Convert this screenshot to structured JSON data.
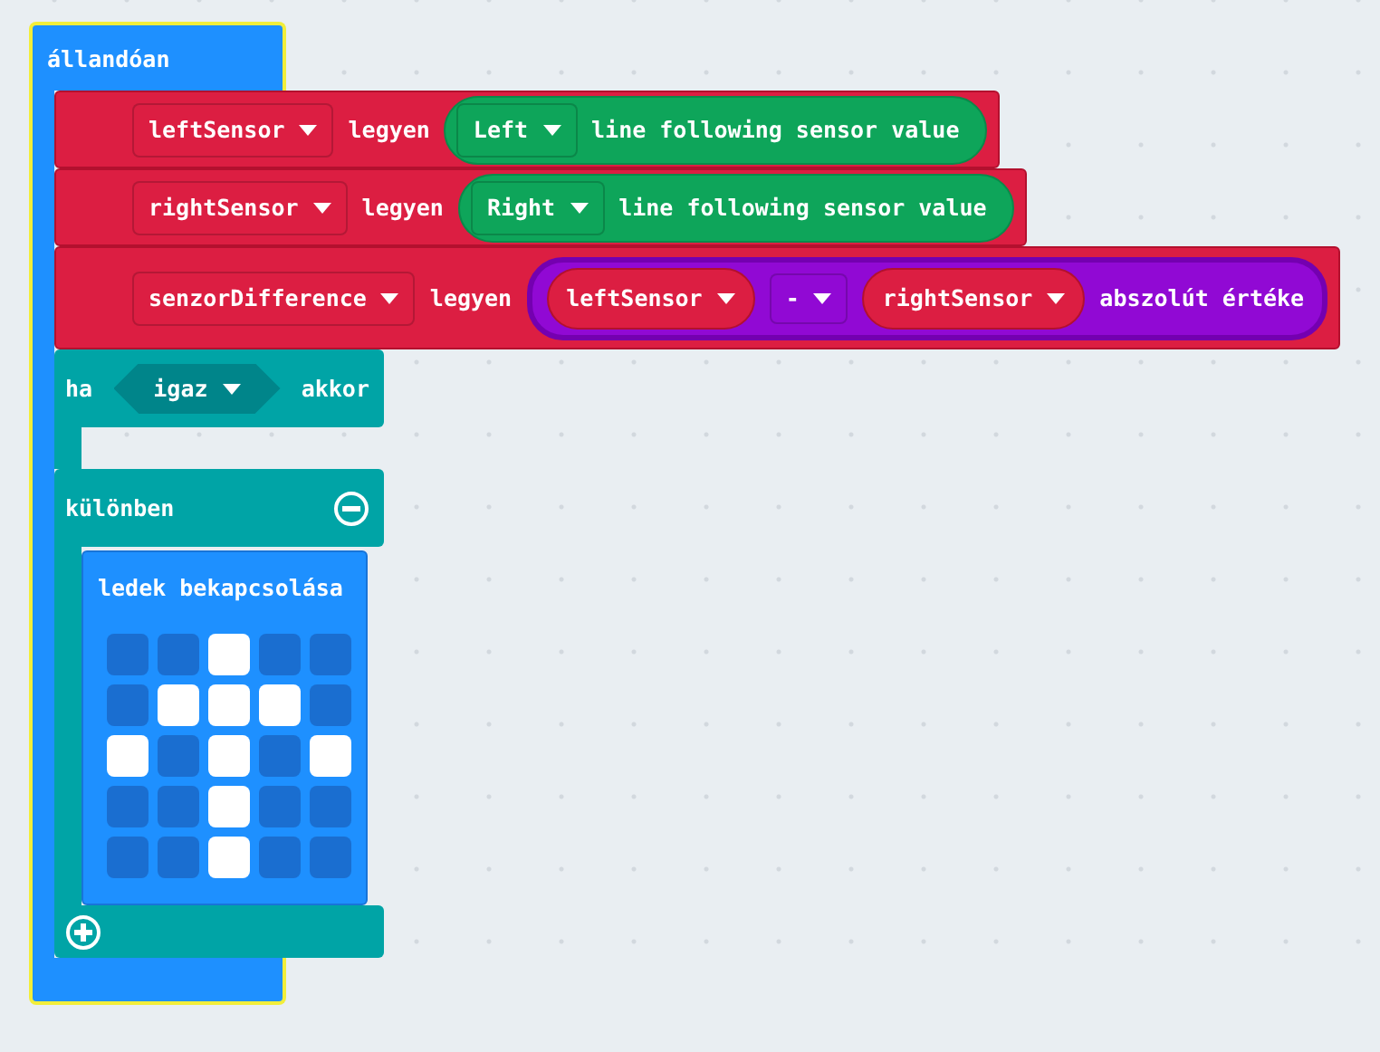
{
  "loop": {
    "label": "állandóan"
  },
  "statements": [
    {
      "kind": "set",
      "variable": "leftSensor",
      "verb": "legyen",
      "value": {
        "kind": "sensor",
        "side": "Left",
        "text": "line following sensor value"
      }
    },
    {
      "kind": "set",
      "variable": "rightSensor",
      "verb": "legyen",
      "value": {
        "kind": "sensor",
        "side": "Right",
        "text": "line following sensor value"
      }
    },
    {
      "kind": "set",
      "variable": "senzorDifference",
      "verb": "legyen",
      "value": {
        "kind": "abs",
        "left": "leftSensor",
        "operator": "-",
        "right": "rightSensor",
        "text": "abszolút értéke"
      }
    }
  ],
  "if_block": {
    "if_label": "ha",
    "condition": "igaz",
    "then_label": "akkor",
    "else_label": "különben",
    "else_body": {
      "title": "ledek bekapcsolása",
      "leds": [
        [
          false,
          false,
          true,
          false,
          false
        ],
        [
          false,
          true,
          true,
          true,
          false
        ],
        [
          true,
          false,
          true,
          false,
          true
        ],
        [
          false,
          false,
          true,
          false,
          false
        ],
        [
          false,
          false,
          true,
          false,
          false
        ]
      ]
    }
  }
}
